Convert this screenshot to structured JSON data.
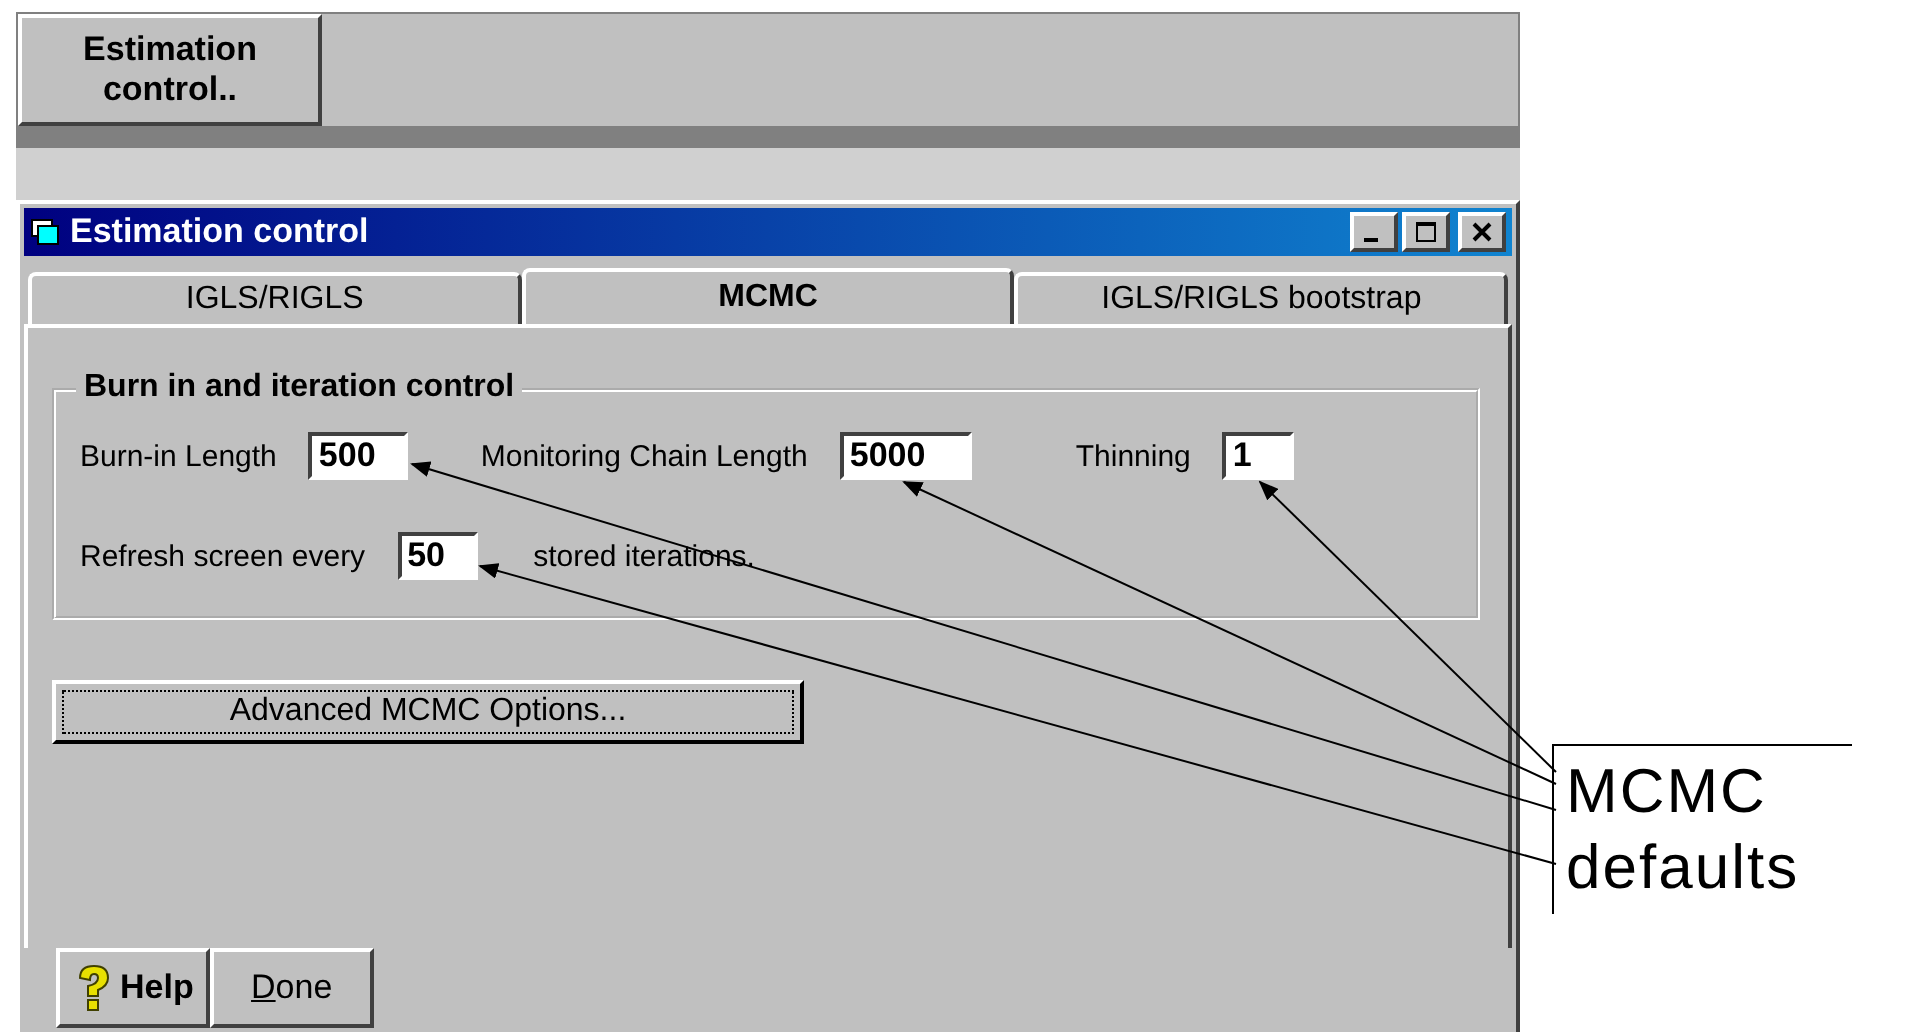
{
  "toolbar": {
    "button": "Estimation control.."
  },
  "window": {
    "title": "Estimation control"
  },
  "tabs": [
    {
      "label": "IGLS/RIGLS",
      "selected": false
    },
    {
      "label": "MCMC",
      "selected": true
    },
    {
      "label": "IGLS/RIGLS bootstrap",
      "selected": false
    }
  ],
  "group": {
    "title": "Burn in and iteration control",
    "fields": [
      {
        "label": "Burn-in Length",
        "value": "500"
      },
      {
        "label": "Monitoring Chain Length",
        "value": "5000"
      },
      {
        "label": "Thinning",
        "value": "1"
      }
    ],
    "refresh": {
      "label": "Refresh screen every",
      "value": "50",
      "suffix": "stored iterations."
    }
  },
  "advanced_button": "Advanced MCMC Options...",
  "buttons": [
    {
      "label": "Help",
      "kind": "help"
    },
    {
      "label": "Done",
      "kind": "plain"
    }
  ],
  "annotation": {
    "text": "MCMC defaults"
  }
}
